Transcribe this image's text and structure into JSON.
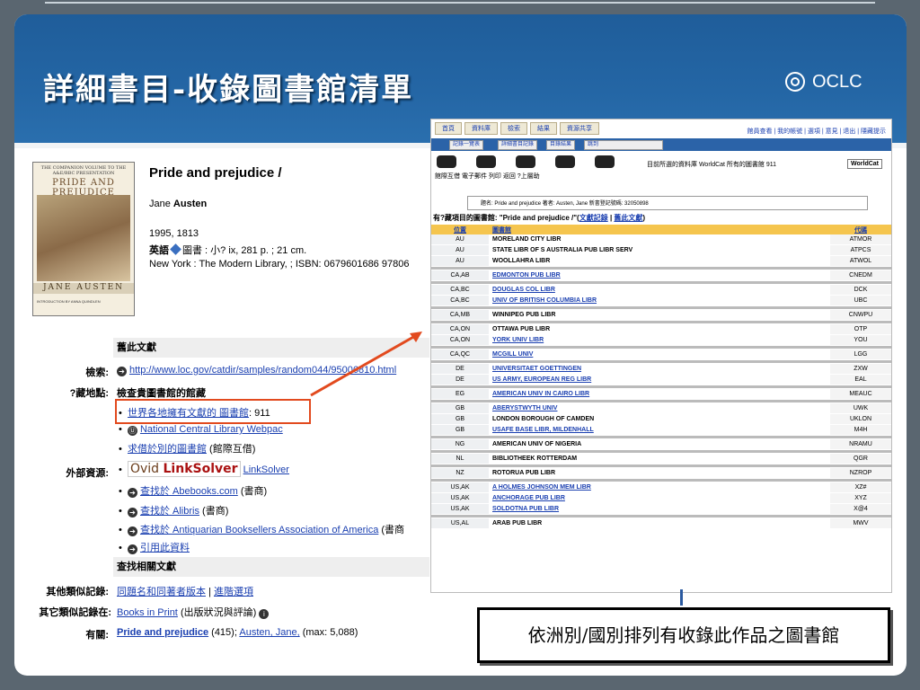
{
  "slide": {
    "title": "詳細書目-收錄圖書館清單",
    "logo_text": "OCLC",
    "caption": "依洲別/國別排列有收錄此作品之圖書館"
  },
  "colors": {
    "band": "#2466a5",
    "header_row": "#f5c54e",
    "highlight": "#e24a1e",
    "link": "#1a3fb0"
  },
  "record": {
    "cover": {
      "top_text": "THE COMPANION VOLUME TO THE A&E/BBC PRESENTATION",
      "title": "PRIDE AND PREJUDICE",
      "author": "JANE AUSTEN",
      "intro": "INTRODUCTION BY ANNA QUINDLEN"
    },
    "title": "Pride and prejudice /",
    "author_first": "Jane",
    "author_last": "Austen",
    "year": "1995, 1813",
    "lang_label": "英語",
    "format": "圖書 : 小? ix, 281 p. ; 21 cm.",
    "publisher": "New York : The Modern Library, ; ISBN: 0679601686 97806",
    "sec_links": "舊此文獻",
    "access_label": "檢索:",
    "access_url": "http://www.loc.gov/catdir/samples/random044/95006810.html",
    "holdings_label": "?藏地點:",
    "holdings_title": "檢查貴圖書館的館藏",
    "world_libs": "世界各地擁有文獻的 圖書館",
    "world_count": ": 911",
    "ncl_link": "National Central Library Webpac",
    "ill_link": "求借於別的圖書館",
    "ill_note": "(館際互借)",
    "external_label": "外部資源:",
    "ovid_text": "Ovid",
    "ovid_bold": "LinkSolver",
    "linksolver": "LinkSolver",
    "abebooks": "查找於 Abebooks.com",
    "abebooks_note": "(書商)",
    "alibris": "查找於 Alibris",
    "alibris_note": "(書商)",
    "antiq": "查找於 Antiquarian Booksellers Association of America",
    "antiq_note": "(書商",
    "cite": "引用此資料",
    "related_sec": "查找相關文獻",
    "other_label": "其他類似記錄:",
    "other_link1": "同題名和同著者版本",
    "other_link2": "進階選項",
    "other2_label": "其它類似記錄在:",
    "bip": "Books in Print",
    "bip_note": "(出版狀況與評論)",
    "subj_label": "有關:",
    "subj_title": "Pride and prejudice",
    "subj_count": "(415);",
    "subj_author": "Austen, Jane,",
    "subj_max": "(max: 5,088)"
  },
  "holdings": {
    "tabs": [
      "首頁",
      "資料庫",
      "檢索",
      "結果",
      "資源共享"
    ],
    "right_links": "館員查看 | 我的帳號 | 選項 | 意見 | 退出 | 隱藏提示",
    "subtabs": [
      "記錄一覽表",
      "詳細書目記錄",
      "目錄結果",
      "跳到"
    ],
    "icon_labels": "館際互借 電子郵件  列印   返回  ?上層助",
    "db_info": "目前所選的資料庫  WorldCat 所有的圖書館  911",
    "wc_logo": "WorldCat",
    "info": "題名: Pride and prejudice 著者: Austen, Jane 新書登記號碼: 32050898",
    "have_prefix": "有?藏項目的圖書館: \"Pride and prejudice /\"(",
    "have_link1": "文獻記錄",
    "have_link2": "舊此文獻",
    "have_suffix": ")",
    "col_loc": "位置",
    "col_lib": "圖書館",
    "col_code": "代碼",
    "rows": [
      {
        "loc": "AU",
        "lib": "MORELAND CITY LIBR",
        "code": "ATMOR",
        "link": false,
        "gap": false
      },
      {
        "loc": "AU",
        "lib": "STATE LIBR OF S AUSTRALIA PUB LIBR SERV",
        "code": "ATPCS",
        "link": false,
        "gap": false
      },
      {
        "loc": "AU",
        "lib": "WOOLLAHRA LIBR",
        "code": "ATWOL",
        "link": false,
        "gap": true
      },
      {
        "loc": "CA,AB",
        "lib": "EDMONTON PUB LIBR",
        "code": "CNEDM",
        "link": true,
        "gap": true
      },
      {
        "loc": "CA,BC",
        "lib": "DOUGLAS COL LIBR",
        "code": "DCK",
        "link": true,
        "gap": false
      },
      {
        "loc": "CA,BC",
        "lib": "UNIV OF BRITISH COLUMBIA LIBR",
        "code": "UBC",
        "link": true,
        "gap": true
      },
      {
        "loc": "CA,MB",
        "lib": "WINNIPEG PUB LIBR",
        "code": "CNWPU",
        "link": false,
        "gap": true
      },
      {
        "loc": "CA,ON",
        "lib": "OTTAWA PUB LIBR",
        "code": "OTP",
        "link": false,
        "gap": false
      },
      {
        "loc": "CA,ON",
        "lib": "YORK UNIV LIBR",
        "code": "YOU",
        "link": true,
        "gap": true
      },
      {
        "loc": "CA,QC",
        "lib": "MCGILL UNIV",
        "code": "LGG",
        "link": true,
        "gap": true
      },
      {
        "loc": "DE",
        "lib": "UNIVERSITAET GOETTINGEN",
        "code": "ZXW",
        "link": true,
        "gap": false
      },
      {
        "loc": "DE",
        "lib": "US ARMY, EUROPEAN REG LIBR",
        "code": "EAL",
        "link": true,
        "gap": true
      },
      {
        "loc": "EG",
        "lib": "AMERICAN UNIV IN CAIRO LIBR",
        "code": "MEAUC",
        "link": true,
        "gap": true
      },
      {
        "loc": "GB",
        "lib": "ABERYSTWYTH UNIV",
        "code": "UWK",
        "link": true,
        "gap": false
      },
      {
        "loc": "GB",
        "lib": "LONDON BOROUGH OF CAMDEN",
        "code": "UKLON",
        "link": false,
        "gap": false
      },
      {
        "loc": "GB",
        "lib": "USAFE BASE LIBR, MILDENHALL",
        "code": "M4H",
        "link": true,
        "gap": true
      },
      {
        "loc": "NG",
        "lib": "AMERICAN UNIV OF NIGERIA",
        "code": "NRAMU",
        "link": false,
        "gap": true
      },
      {
        "loc": "NL",
        "lib": "BIBLIOTHEEK ROTTERDAM",
        "code": "QGR",
        "link": false,
        "gap": true
      },
      {
        "loc": "NZ",
        "lib": "ROTORUA PUB LIBR",
        "code": "NZROP",
        "link": false,
        "gap": true
      },
      {
        "loc": "US,AK",
        "lib": "A HOLMES JOHNSON MEM LIBR",
        "code": "XZ#",
        "link": true,
        "gap": false
      },
      {
        "loc": "US,AK",
        "lib": "ANCHORAGE PUB LIBR",
        "code": "XYZ",
        "link": true,
        "gap": false
      },
      {
        "loc": "US,AK",
        "lib": "SOLDOTNA PUB LIBR",
        "code": "X@4",
        "link": true,
        "gap": true
      },
      {
        "loc": "US,AL",
        "lib": "ARAB PUB LIBR",
        "code": "MWV",
        "link": false,
        "gap": false
      }
    ]
  }
}
